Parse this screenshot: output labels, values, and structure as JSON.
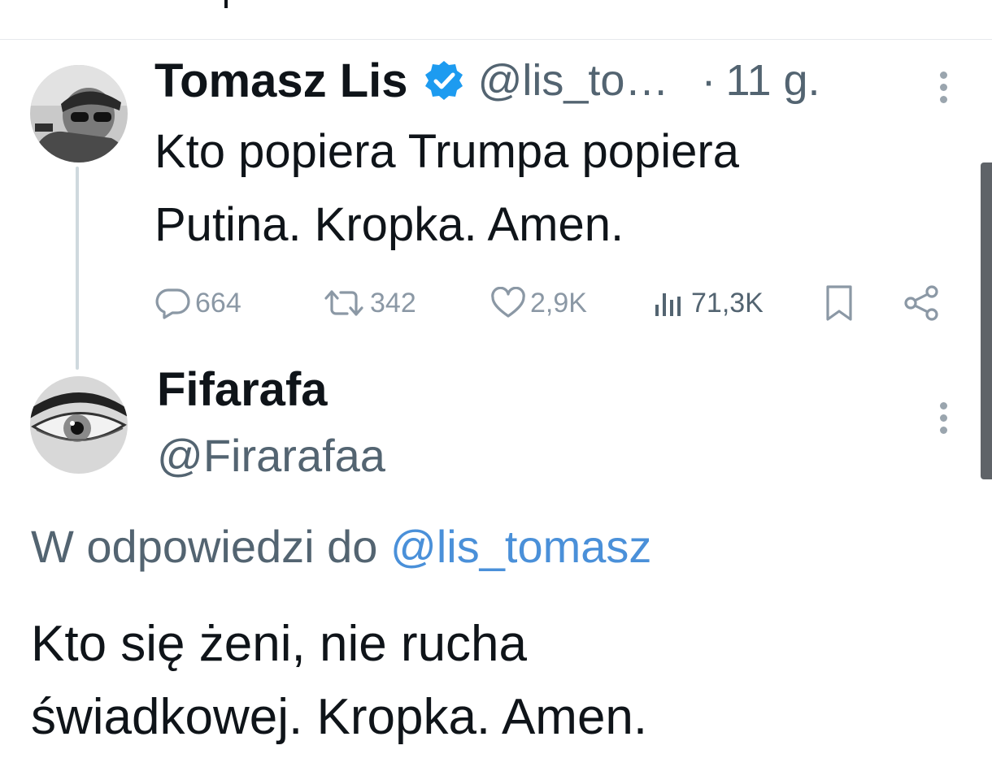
{
  "thread": [
    {
      "author": {
        "name": "Tomasz Lis",
        "handle": "@lis_to…",
        "verified": true
      },
      "separator": "·",
      "time": "11 g.",
      "text_lines": [
        "Kto popiera Trumpa popiera",
        "Putina. Kropka. Amen."
      ],
      "stats": {
        "replies": "664",
        "retweets": "342",
        "likes": "2,9K",
        "views": "71,3K"
      }
    },
    {
      "author": {
        "name": "Fifarafa",
        "handle": "@Firarafaa"
      },
      "reply_context": {
        "prefix": "W odpowiedzi do",
        "mention": "@lis_tomasz"
      },
      "text_lines": [
        "Kto się żeni, nie rucha",
        "świadkowej. Kropka. Amen."
      ]
    }
  ],
  "colors": {
    "text": "#0f1419",
    "secondary": "#536471",
    "icon_gray": "#8b98a5",
    "mention_blue": "#4a90d9",
    "verified_blue": "#1d9bf0",
    "thread_line": "#cfd9de"
  },
  "icons": [
    "verified-badge-icon",
    "more-icon",
    "reply-icon",
    "retweet-icon",
    "like-icon",
    "views-icon",
    "bookmark-icon",
    "share-icon"
  ]
}
